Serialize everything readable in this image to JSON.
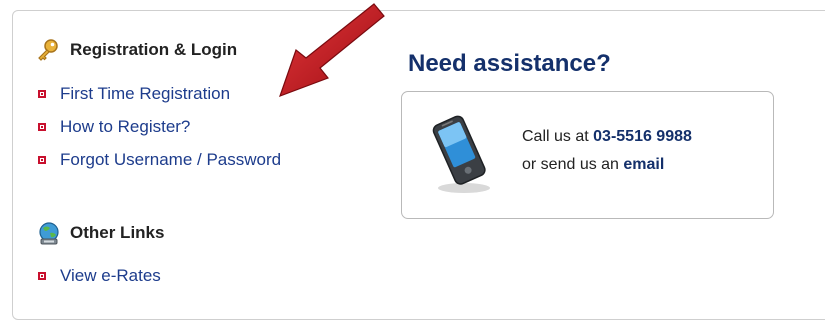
{
  "registration": {
    "heading": "Registration & Login",
    "icon": "key-icon",
    "links": [
      {
        "label": "First Time Registration"
      },
      {
        "label": "How to Register?"
      },
      {
        "label": "Forgot Username / Password"
      }
    ]
  },
  "other": {
    "heading": "Other Links",
    "icon": "globe-network-icon",
    "links": [
      {
        "label": "View e-Rates"
      }
    ]
  },
  "assistance": {
    "title": "Need assistance?",
    "line1_prefix": "Call us at ",
    "phone": "03-5516 9988",
    "line2_prefix": "or send us an ",
    "email_label": "email"
  },
  "colors": {
    "link": "#1d3c8c",
    "bullet": "#c8102e",
    "heading_blue": "#14306b",
    "arrow": "#c0121c"
  }
}
